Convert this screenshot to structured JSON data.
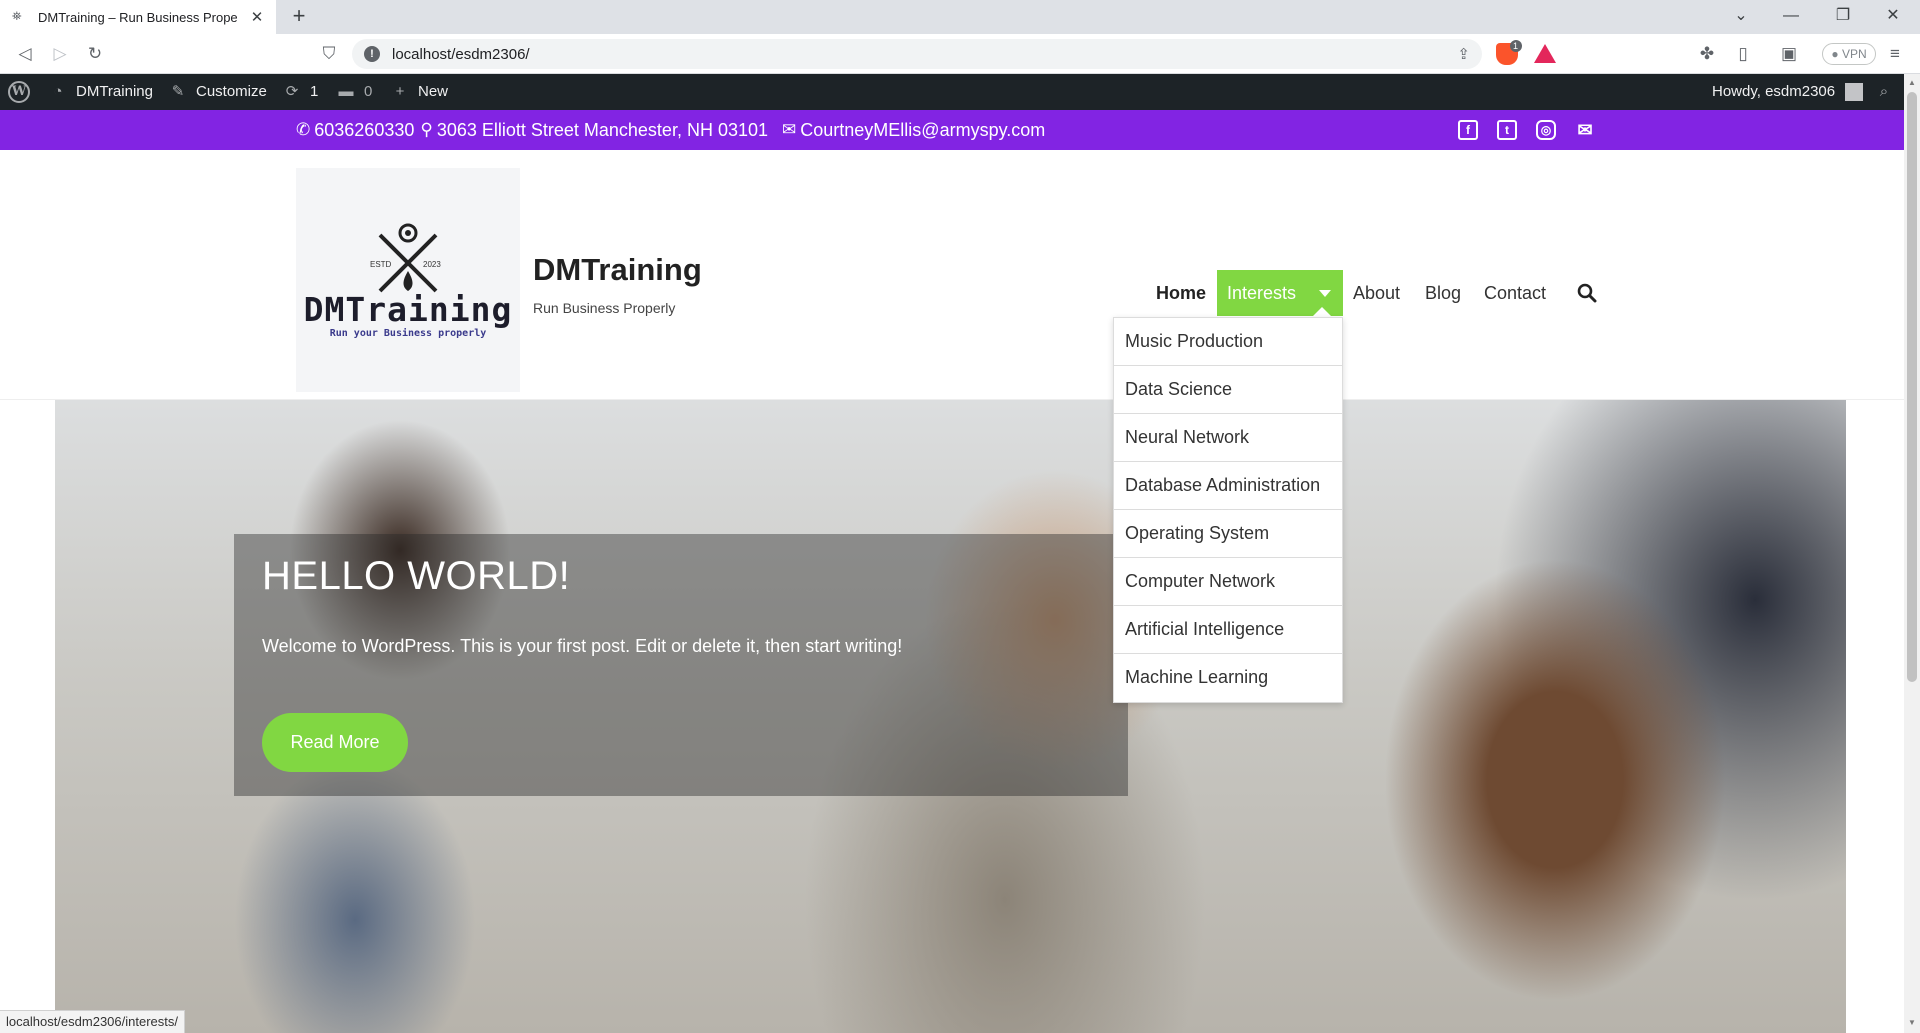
{
  "browser": {
    "tab_title": "DMTraining – Run Business Prope",
    "url": "localhost/esdm2306/",
    "brave_badge": "1",
    "vpn_label": "VPN"
  },
  "adminbar": {
    "site": "DMTraining",
    "customize": "Customize",
    "updates_count": "1",
    "comments_count": "0",
    "new": "New",
    "greeting": "Howdy, esdm2306"
  },
  "topbar": {
    "phone": "6036260330",
    "address": "3063 Elliott Street Manchester, NH 03101",
    "email": "CourtneyMEllis@armyspy.com",
    "social_icons": [
      "facebook-icon",
      "twitter-icon",
      "instagram-icon",
      "email-icon"
    ]
  },
  "header": {
    "logo_text": "DMTraining",
    "logo_tagline": "Run your Business properly",
    "logo_estd": "ESTD",
    "logo_year": "2023",
    "site_title": "DMTraining",
    "site_description": "Run Business Properly"
  },
  "nav": {
    "items": [
      {
        "label": "Home"
      },
      {
        "label": "Interests"
      },
      {
        "label": "About"
      },
      {
        "label": "Blog"
      },
      {
        "label": "Contact"
      }
    ],
    "accent": "#81d742"
  },
  "dropdown": {
    "items": [
      "Music Production",
      "Data Science",
      "Neural Network",
      "Database Administration",
      "Operating System",
      "Computer Network",
      "Artificial Intelligence",
      "Machine Learning"
    ]
  },
  "hero": {
    "title": "HELLO WORLD!",
    "text": "Welcome to WordPress. This is your first post. Edit or delete it, then start writing!",
    "button": "Read More"
  },
  "status_url": "localhost/esdm2306/interests/",
  "colors": {
    "topbar": "#8224e3",
    "accent": "#81d742",
    "adminbar": "#1d2327"
  }
}
